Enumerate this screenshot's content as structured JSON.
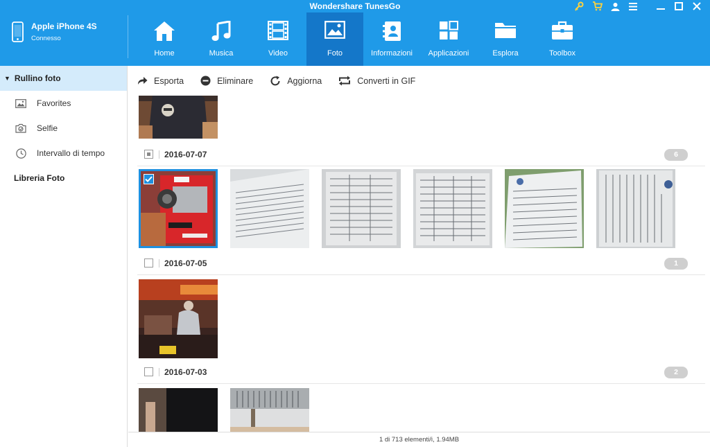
{
  "app": {
    "title": "Wondershare TunesGo"
  },
  "device": {
    "name": "Apple iPhone 4S",
    "status": "Connesso"
  },
  "nav": [
    {
      "id": "home",
      "label": "Home",
      "icon": "home-icon",
      "active": false
    },
    {
      "id": "music",
      "label": "Musica",
      "icon": "music-icon",
      "active": false
    },
    {
      "id": "video",
      "label": "Video",
      "icon": "film-icon",
      "active": false
    },
    {
      "id": "photo",
      "label": "Foto",
      "icon": "image-icon",
      "active": true
    },
    {
      "id": "info",
      "label": "Informazioni",
      "icon": "contacts-icon",
      "active": false
    },
    {
      "id": "apps",
      "label": "Applicazioni",
      "icon": "apps-grid-icon",
      "active": false
    },
    {
      "id": "explore",
      "label": "Esplora",
      "icon": "folder-icon",
      "active": false
    },
    {
      "id": "toolbox",
      "label": "Toolbox",
      "icon": "briefcase-icon",
      "active": false
    }
  ],
  "window_controls": [
    "key-icon",
    "cart-icon",
    "user-icon",
    "menu-icon",
    "minimize-icon",
    "maximize-icon",
    "close-icon"
  ],
  "sidebar": {
    "head": "Rullino foto",
    "items": [
      {
        "label": "Favorites",
        "icon": "picture-icon"
      },
      {
        "label": "Selfie",
        "icon": "selfie-camera-icon"
      },
      {
        "label": "Intervallo di tempo",
        "icon": "clock-icon"
      }
    ],
    "section": "Libreria Foto"
  },
  "toolbar": {
    "export": "Esporta",
    "delete": "Eliminare",
    "refresh": "Aggiorna",
    "gif": "Converti in GIF"
  },
  "groups": [
    {
      "date": "2016-07-07",
      "count": "6",
      "check": "partial"
    },
    {
      "date": "2016-07-05",
      "count": "1",
      "check": "none"
    },
    {
      "date": "2016-07-03",
      "count": "2",
      "check": "none"
    }
  ],
  "status": "1 di 713 elementi/i, 1.94MB",
  "colors": {
    "accent": "#1f9ae8",
    "active_tab": "#1477c9",
    "sidebar_active": "#d4ebfb",
    "selection": "#1e90e0"
  }
}
